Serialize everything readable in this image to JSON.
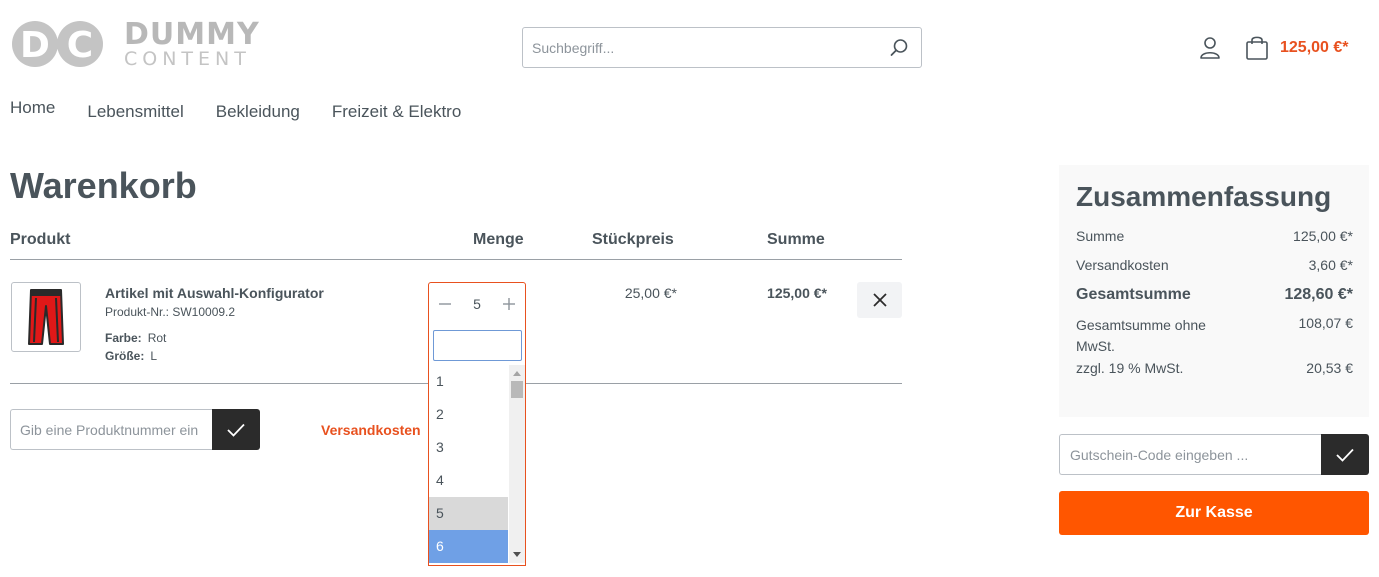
{
  "brand": {
    "mark": "DC",
    "line1": "DUMMY",
    "line2": "CONTENT"
  },
  "search": {
    "placeholder": "Suchbegriff..."
  },
  "header": {
    "cart_total": "125,00 €*"
  },
  "nav": [
    "Home",
    "Lebensmittel",
    "Bekleidung",
    "Freizeit & Elektro"
  ],
  "cart": {
    "title": "Warenkorb",
    "columns": {
      "product": "Produkt",
      "quantity": "Menge",
      "unit_price": "Stückpreis",
      "sum": "Summe"
    },
    "item": {
      "name": "Artikel mit Auswahl-Konfigurator",
      "number": "Produkt-Nr.: SW10009.2",
      "options": [
        {
          "label": "Farbe:",
          "value": "Rot"
        },
        {
          "label": "Größe:",
          "value": "L"
        }
      ],
      "quantity": "5",
      "unit_price": "25,00 €*",
      "total": "125,00 €*"
    },
    "quantity_options": [
      "1",
      "2",
      "3",
      "4",
      "5",
      "6"
    ],
    "quantity_highlighted": "5",
    "quantity_selected": "6",
    "product_number_placeholder": "Gib eine Produktnummer ein",
    "shipping_link": "Versandkosten"
  },
  "summary": {
    "title": "Zusammenfassung",
    "rows": [
      {
        "label": "Summe",
        "value": "125,00 €*"
      },
      {
        "label": "Versandkosten",
        "value": "3,60 €*"
      },
      {
        "label": "Gesamtsumme",
        "value": "128,60 €*"
      },
      {
        "label": "Gesamtsumme ohne MwSt.",
        "value": "108,07 €"
      },
      {
        "label": "zzgl. 19 % MwSt.",
        "value": "20,53 €"
      }
    ],
    "voucher_placeholder": "Gutschein-Code eingeben ...",
    "checkout_label": "Zur Kasse"
  },
  "colors": {
    "accent": "#e8511f",
    "checkout": "#ff5600",
    "dark": "#2b2b2b",
    "text": "#4a545b"
  },
  "icons": [
    "search-icon",
    "account-icon",
    "cart-icon",
    "minus-icon",
    "plus-icon",
    "close-icon",
    "check-icon"
  ]
}
